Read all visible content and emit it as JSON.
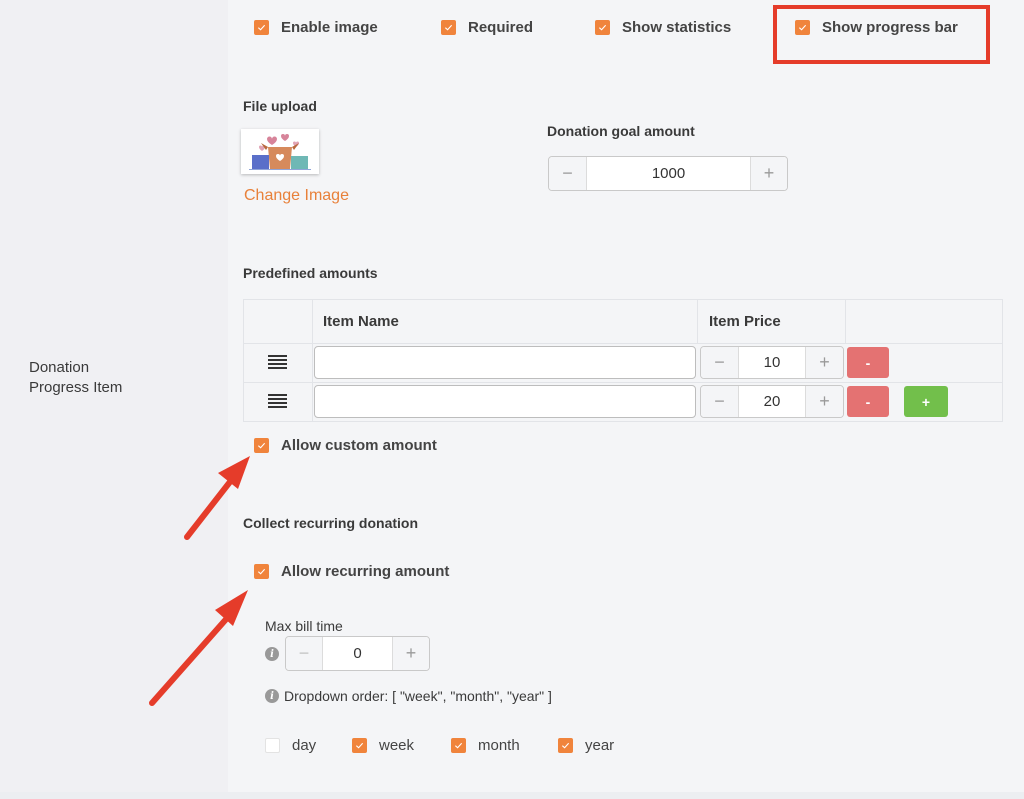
{
  "field": {
    "label": "Donation Progress Item"
  },
  "options": [
    {
      "label": "Enable image",
      "checked": true
    },
    {
      "label": "Required",
      "checked": true
    },
    {
      "label": "Show statistics",
      "checked": true
    },
    {
      "label": "Show progress bar",
      "checked": true
    }
  ],
  "file_upload": {
    "title": "File upload",
    "image_alt": "donation boxes image",
    "change_label": "Change Image"
  },
  "goal": {
    "title": "Donation goal amount",
    "value": "1000",
    "minus": "−",
    "plus": "+"
  },
  "predefined": {
    "title": "Predefined amounts",
    "columns": [
      "",
      "Item Name",
      "Item Price",
      ""
    ],
    "rows": [
      {
        "name": "",
        "price": "10",
        "remove_label": "-"
      },
      {
        "name": "",
        "price": "20",
        "remove_label": "-",
        "add_label": "+"
      }
    ],
    "stepper_minus": "−",
    "stepper_plus": "+"
  },
  "custom_amount": {
    "label": "Allow custom amount",
    "checked": true
  },
  "recurring": {
    "title": "Collect recurring donation",
    "allow": {
      "label": "Allow recurring amount",
      "checked": true
    },
    "max_bill_time": {
      "label": "Max bill time",
      "value": "0",
      "minus": "−",
      "plus": "+"
    },
    "info_glyph": "i",
    "dropdown_order": "Dropdown order: [ \"week\", \"month\", \"year\" ]",
    "periods": [
      {
        "label": "day",
        "checked": false
      },
      {
        "label": "week",
        "checked": true
      },
      {
        "label": "month",
        "checked": true
      },
      {
        "label": "year",
        "checked": true
      }
    ]
  },
  "annotations": {
    "highlight_color": "#e53c2a",
    "accent": "#f0843c",
    "danger": "#e47272",
    "success": "#72bf4b"
  }
}
